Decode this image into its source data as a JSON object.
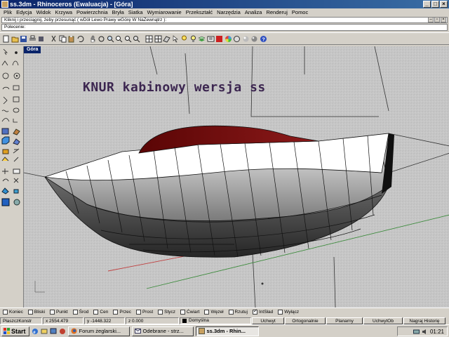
{
  "window": {
    "title": "ss.3dm - Rhinoceros (Ewaluacja) - [Góra]",
    "controls": [
      "_",
      "□",
      "×"
    ]
  },
  "menu": [
    "Plik",
    "Edycja",
    "Widok",
    "Krzywa",
    "Powierzchnia",
    "Bryła",
    "Siatka",
    "Wymiarowanie",
    "Przekształć",
    "Narzędzia",
    "Analiza",
    "Renderuj",
    "Pomoc"
  ],
  "command": {
    "history": "Kliknij i przeciągnij, żeby przesunąć ( wDół Lewo Prawy wGórę W NaZewnątrz ):",
    "prompt": "Polecenie:"
  },
  "viewport": {
    "tab_label": "Góra",
    "title_text": "KNUR kabinowy wersja ss",
    "title_color": "#3c2650",
    "hull_color": "#ffffff",
    "cabin_color": "#7a0a0a",
    "background_color": "#c6c6c6"
  },
  "osnap": [
    {
      "label": "Koniec",
      "checked": false
    },
    {
      "label": "Bliski",
      "checked": false
    },
    {
      "label": "Punkt",
      "checked": false
    },
    {
      "label": "Środ",
      "checked": false
    },
    {
      "label": "Cen",
      "checked": false
    },
    {
      "label": "Przec",
      "checked": false
    },
    {
      "label": "Prost",
      "checked": false
    },
    {
      "label": "Stycz",
      "checked": false
    },
    {
      "label": "Ćwiart",
      "checked": false
    },
    {
      "label": "Węzeł",
      "checked": false
    },
    {
      "label": "Rzutuj",
      "checked": false
    },
    {
      "label": "IntSład",
      "checked": true
    },
    {
      "label": "Wyłącz",
      "checked": false
    }
  ],
  "status": {
    "cplane": "PłaszczKonstr",
    "x": "x 2554.479",
    "y": "y -1448.322",
    "z": "z 0.000",
    "layer": "Domyślna",
    "snap": "Uchwyt",
    "ortho": "Ortogonalnie",
    "planar": "Planarny",
    "osnap": "UchwytOb",
    "history": "Nagraj Historię"
  },
  "taskbar": {
    "start": "Start",
    "tasks": [
      "Forum żeglarski...",
      "Odebrane - strz...",
      "ss.3dm - Rhin..."
    ],
    "active_task": 2,
    "clock": "01:21"
  }
}
